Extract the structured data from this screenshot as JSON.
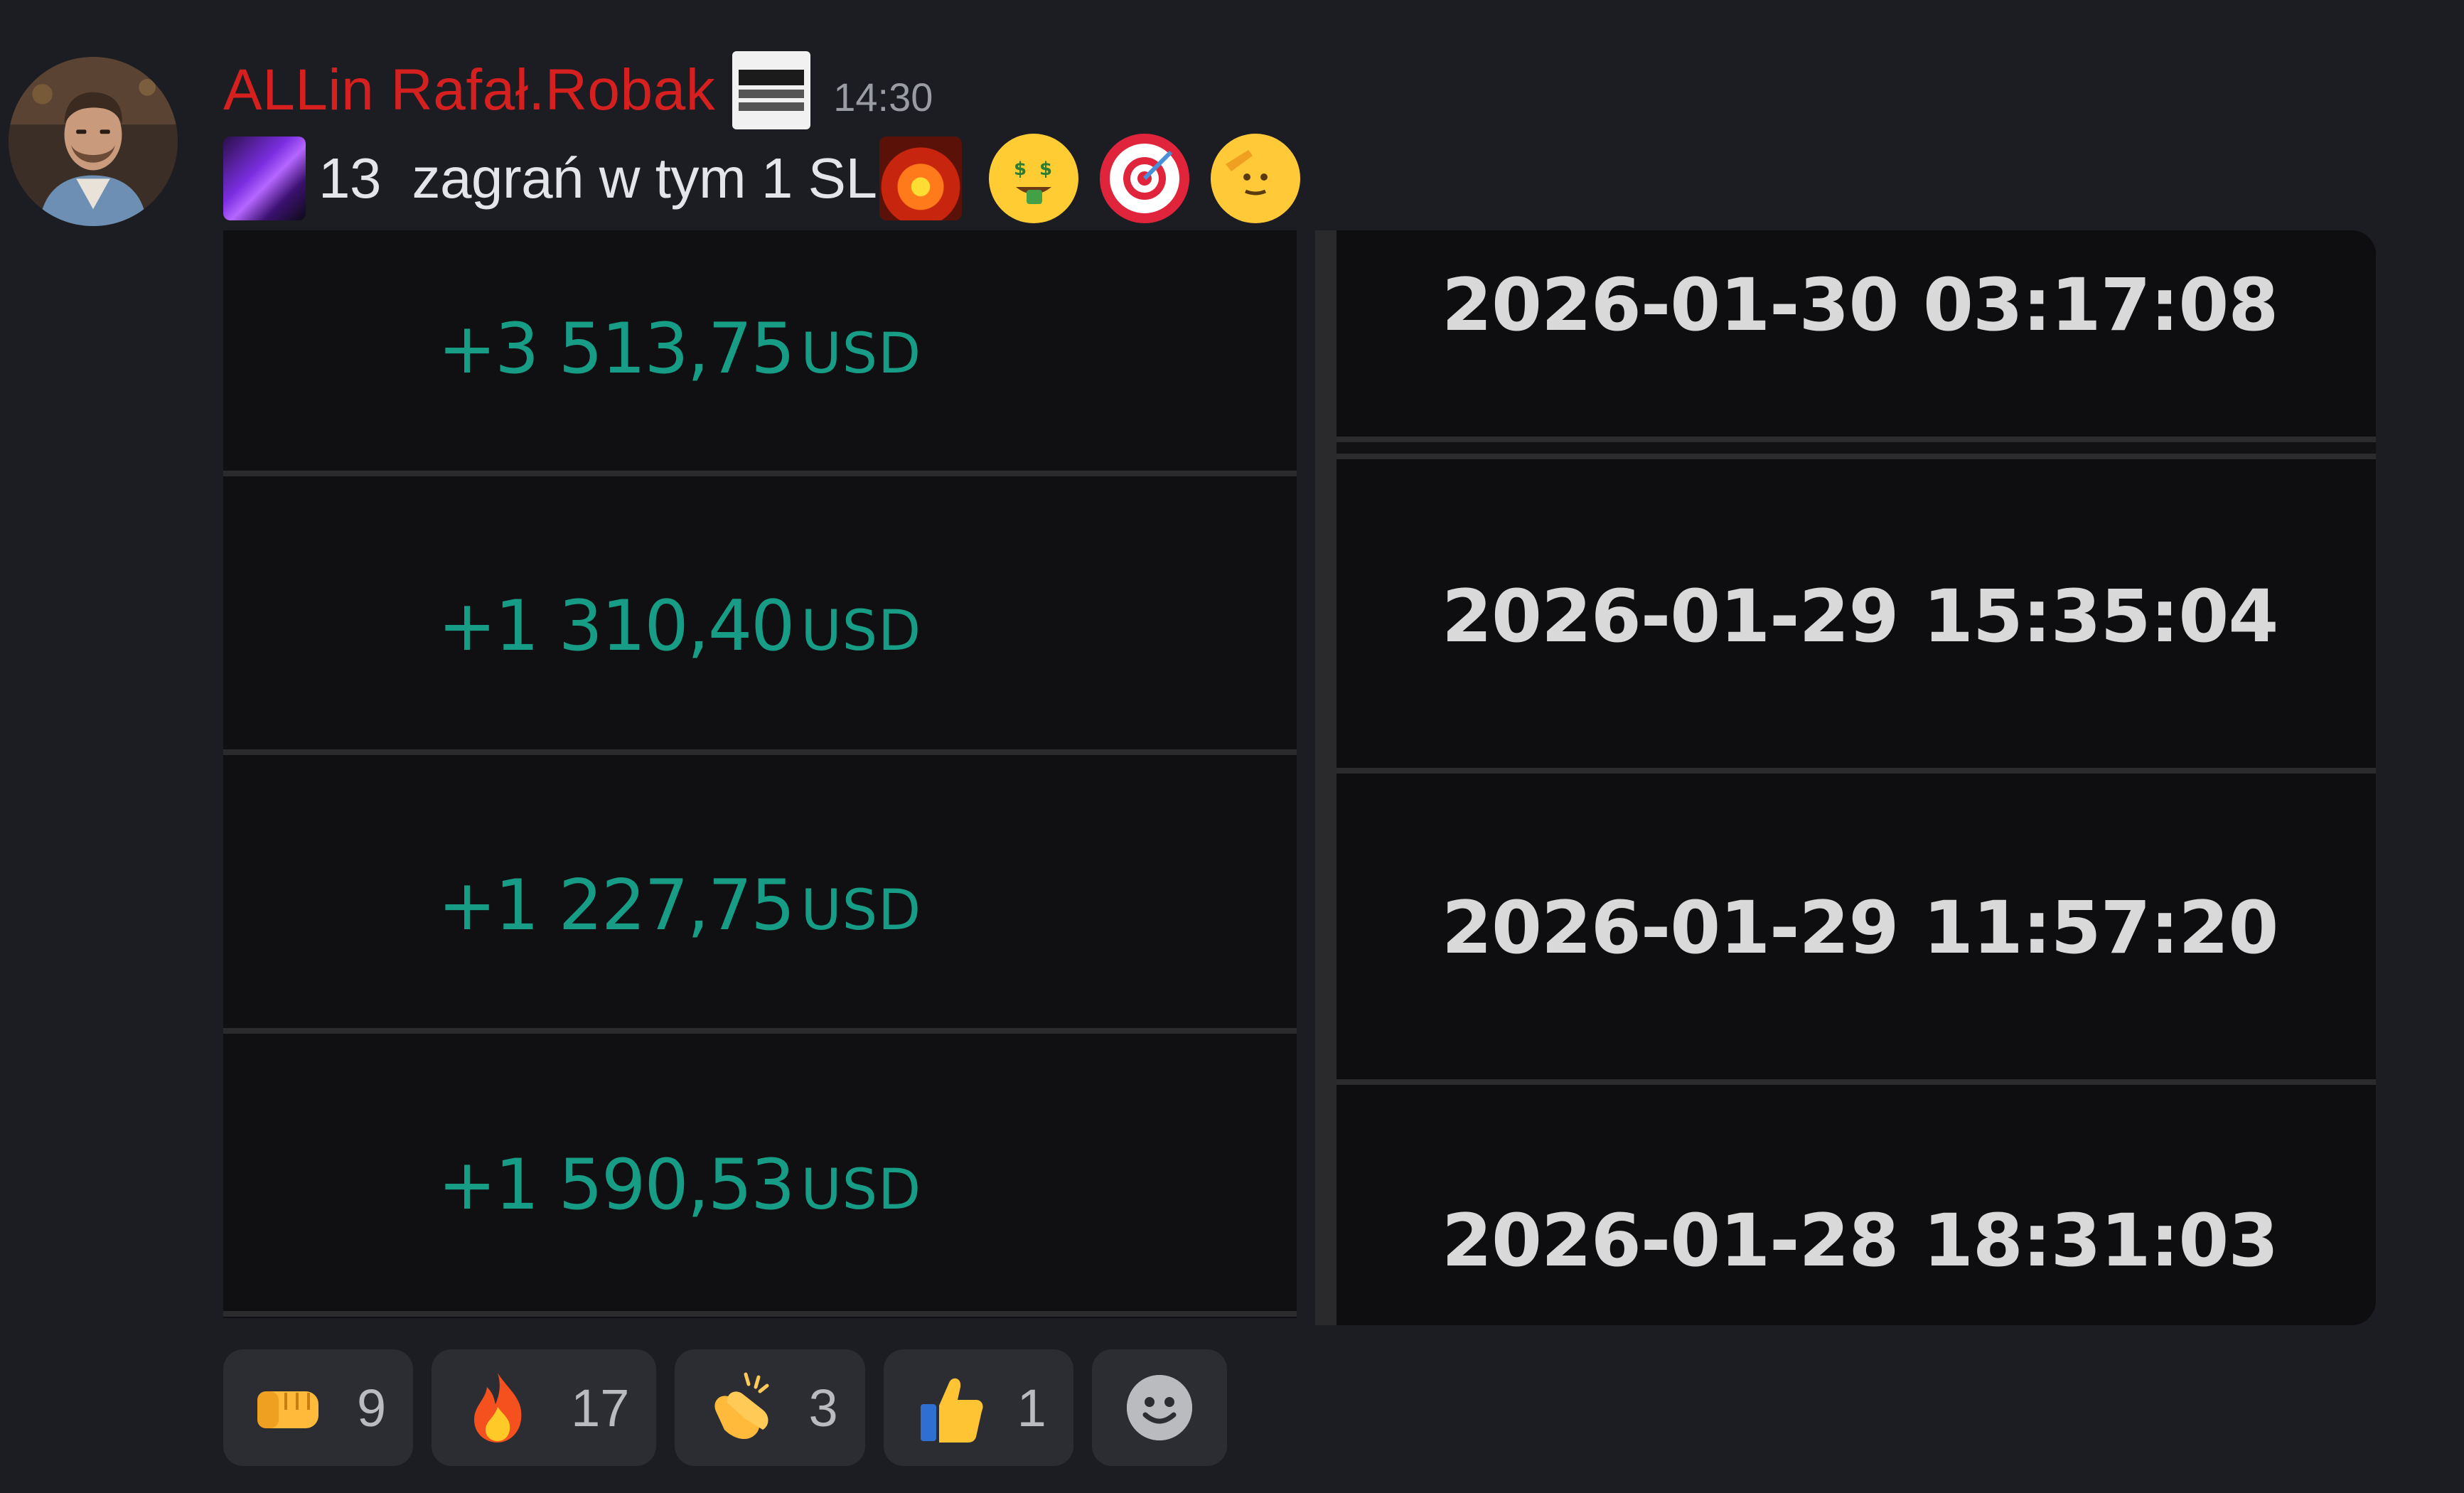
{
  "message": {
    "author": "ALLin Rafał.Robak",
    "time": "14:30",
    "avatar_icon": "user-avatar-photo",
    "role_badge_icon": "brand-logo-badge",
    "content_text": "13  zagrań w tym 1 SL",
    "content_emojis": [
      "crystal-custom-emoji",
      "fire-monster-custom-emoji",
      "money-mouth-face-emoji",
      "direct-hit-target-emoji",
      "saluting-face-emoji"
    ]
  },
  "attachment": {
    "amounts": [
      {
        "value": "+3 513,75",
        "unit": "USD"
      },
      {
        "value": "+1 310,40",
        "unit": "USD"
      },
      {
        "value": "+1 227,75",
        "unit": "USD"
      },
      {
        "value": "+1 590,53",
        "unit": "USD"
      }
    ],
    "datetimes": [
      "2026-01-30 03:17:08",
      "2026-01-29 15:35:04",
      "2026-01-29 11:57:20",
      "2026-01-28 18:31:03"
    ],
    "colors": {
      "amount": "#179c86",
      "datetime": "#d9d9d9",
      "panel_bg": "#101012"
    }
  },
  "reactions": [
    {
      "emoji": "oncoming-fist-emoji",
      "count": "9"
    },
    {
      "emoji": "fire-emoji",
      "count": "17"
    },
    {
      "emoji": "clapping-hands-emoji",
      "count": "3"
    },
    {
      "emoji": "thumbs-up-emoji",
      "count": "1"
    }
  ],
  "add_reaction_icon": "add-reaction-smiley-icon",
  "colors": {
    "background": "#1c1d22",
    "username": "#d61f1f",
    "timestamp": "#9a9ca3",
    "text": "#e3e5e8",
    "reaction_bg": "#2c2d32"
  }
}
